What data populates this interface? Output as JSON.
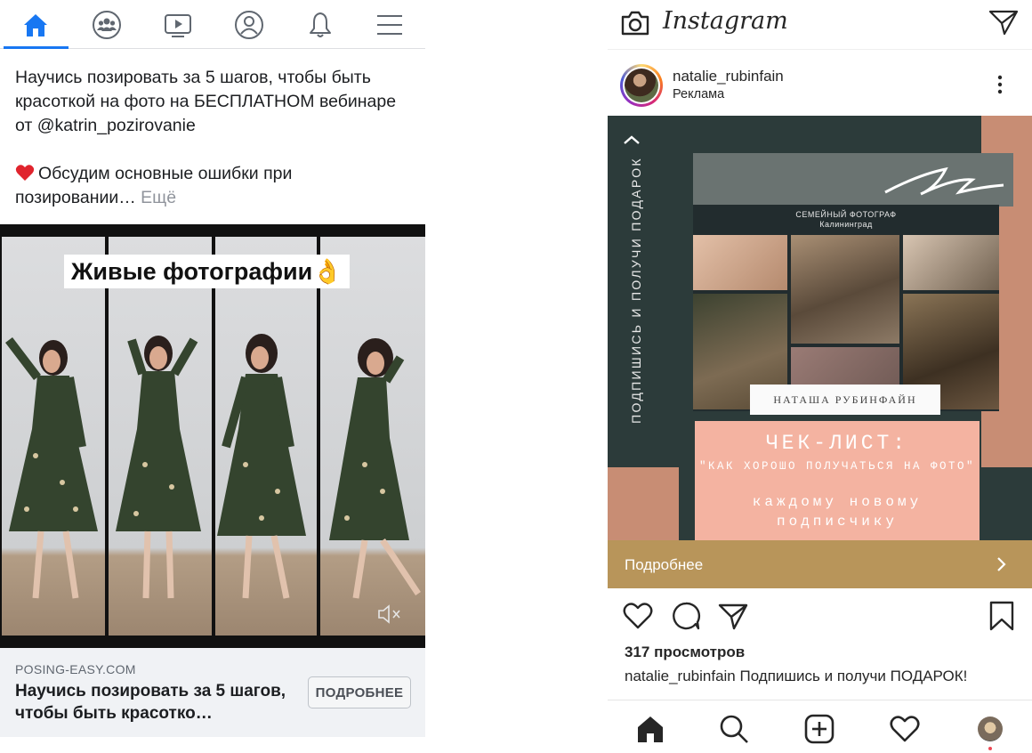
{
  "facebook": {
    "nav": {
      "icons": [
        "home-icon",
        "groups-icon",
        "watch-icon",
        "profile-icon",
        "notifications-icon",
        "menu-icon"
      ],
      "active_color": "#1877f2"
    },
    "post": {
      "line1": "Научись позировать за 5 шагов, чтобы быть красоткой на фото на БЕСПЛАТНОМ вебинаре от @katrin_pozirovanie",
      "line2": "Обсудим основные ошибки при позировании…",
      "more": "Ещё",
      "video_caption": "Живые фотографии👌"
    },
    "link": {
      "domain": "POSING-EASY.COM",
      "headline": "Научись позировать за 5 шагов, чтобы быть красотко…",
      "cta": "ПОДРОБНЕЕ"
    }
  },
  "instagram": {
    "logo": "Instagram",
    "username": "natalie_rubinfain",
    "sponsored": "Реклама",
    "creative": {
      "vertical_text": "ПОДПИШИСЬ И ПОЛУЧИ ПОДАРОК",
      "band_line1": "СЕМЕЙНЫЙ ФОТОГРАФ",
      "band_line2": "Калининград",
      "name_plate": "НАТАША РУБИНФАЙН",
      "title": "ЧЕК-ЛИСТ:",
      "subtitle": "\"КАК ХОРОШО ПОЛУЧАТЬСЯ НА ФОТО\"",
      "offer": "каждому новому подписчику"
    },
    "cta": "Подробнее",
    "views": "317 просмотров",
    "caption_user": "natalie_rubinfain",
    "caption_text": "Подпишись и получи ПОДАРОК!",
    "colors": {
      "cta_bar": "#b8955a",
      "creative_bg": "#2c3b3a",
      "pink": "#f4b3a1"
    },
    "bottom_nav": [
      "home-icon",
      "search-icon",
      "new-post-icon",
      "activity-icon",
      "profile-avatar"
    ]
  }
}
